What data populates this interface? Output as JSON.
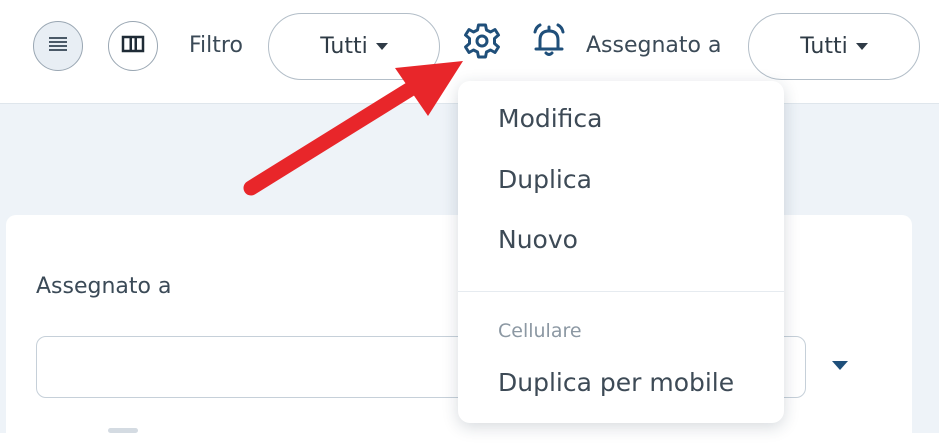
{
  "toolbar": {
    "list_view_icon": "list-icon",
    "columns_view_icon": "columns-icon",
    "filter_label": "Filtro",
    "filter_value": "Tutti",
    "settings_icon": "gear-icon",
    "alarm_icon": "alarm-bell-icon",
    "assigned_label": "Assegnato a",
    "assigned_value": "Tutti"
  },
  "settings_menu": {
    "items": [
      {
        "label": "Modifica"
      },
      {
        "label": "Duplica"
      },
      {
        "label": "Nuovo"
      }
    ],
    "section_header": "Cellulare",
    "mobile_items": [
      {
        "label": "Duplica per mobile"
      }
    ]
  },
  "form": {
    "assigned_label": "Assegnato a",
    "assigned_value": ""
  },
  "annotation": {
    "arrow_color": "#e8262a"
  },
  "colors": {
    "page_background": "#eef3f8",
    "accent": "#1f4f7a"
  }
}
